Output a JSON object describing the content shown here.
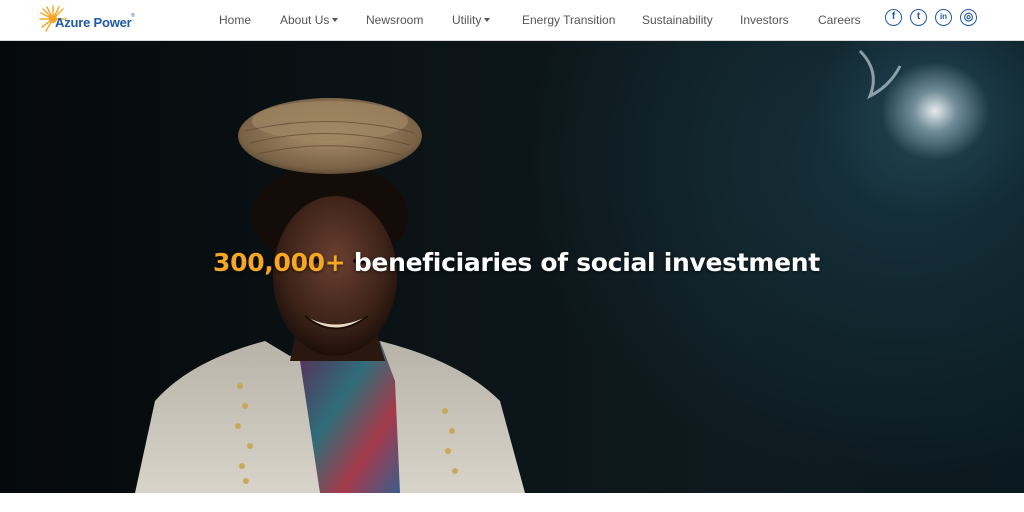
{
  "brand": {
    "name": "Azure Power",
    "registered_mark": "®",
    "colors": {
      "primary": "#1f5aa6",
      "sun": "#f5a623",
      "accent": "#f5a623"
    }
  },
  "nav": {
    "items": [
      {
        "label": "Home",
        "has_dropdown": false
      },
      {
        "label": "About Us",
        "has_dropdown": true
      },
      {
        "label": "Newsroom",
        "has_dropdown": false
      },
      {
        "label": "Utility",
        "has_dropdown": true
      },
      {
        "label": "Energy Transition",
        "has_dropdown": false
      },
      {
        "label": "Sustainability",
        "has_dropdown": false
      },
      {
        "label": "Investors",
        "has_dropdown": false
      },
      {
        "label": "Careers",
        "has_dropdown": false
      }
    ]
  },
  "social": [
    {
      "icon": "facebook-icon",
      "glyph": "f"
    },
    {
      "icon": "twitter-icon",
      "glyph": "t"
    },
    {
      "icon": "linkedin-icon",
      "glyph": "in"
    },
    {
      "icon": "instagram-icon",
      "glyph": "◎"
    }
  ],
  "hero": {
    "headline_number": "300,000+",
    "headline_text": " beneficiaries of social investment"
  }
}
